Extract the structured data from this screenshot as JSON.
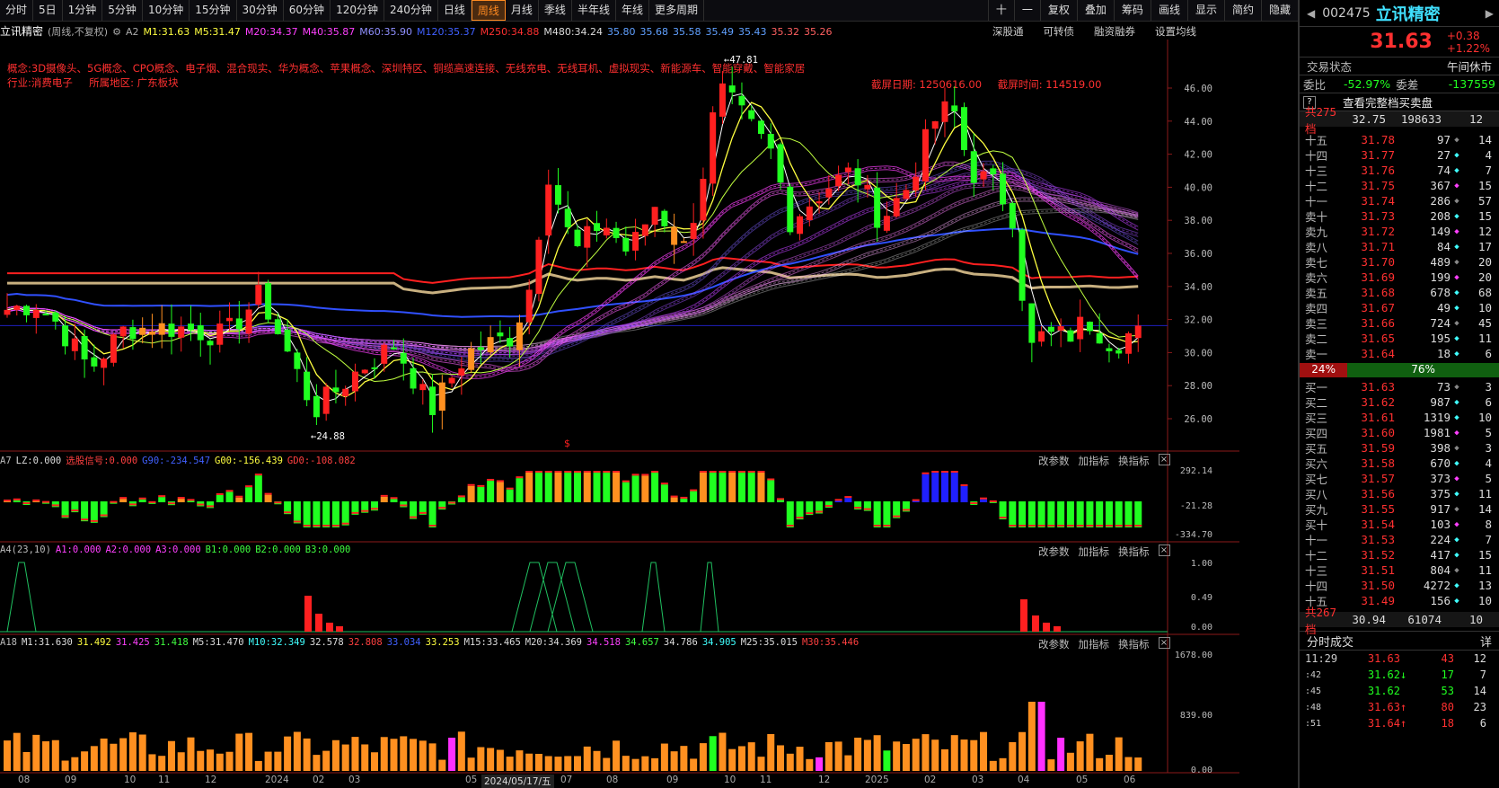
{
  "period_bar": {
    "items": [
      "分时",
      "5日",
      "1分钟",
      "5分钟",
      "10分钟",
      "15分钟",
      "30分钟",
      "60分钟",
      "120分钟",
      "240分钟",
      "日线",
      "周线",
      "月线",
      "季线",
      "半年线",
      "年线",
      "更多周期"
    ],
    "active": "周线",
    "right": [
      "十",
      "一",
      "复权",
      "叠加",
      "筹码",
      "画线",
      "显示",
      "简约",
      "隐藏"
    ]
  },
  "main_info": {
    "name": "立讯精密",
    "mode": "(周线,不复权)",
    "formula": "A2",
    "items": [
      {
        "t": "M1:31.63",
        "c": "#ffff40"
      },
      {
        "t": "M5:31.47",
        "c": "#ffff40"
      },
      {
        "t": "M20:34.37",
        "c": "#ff40ff"
      },
      {
        "t": "M40:35.87",
        "c": "#ff40ff"
      },
      {
        "t": "M60:35.90",
        "c": "#9090ff"
      },
      {
        "t": "M120:35.37",
        "c": "#4060ff"
      },
      {
        "t": "M250:34.88",
        "c": "#ff3030"
      },
      {
        "t": "M480:34.24",
        "c": "#ddd"
      },
      {
        "t": "35.80",
        "c": "#60a0ff"
      },
      {
        "t": "35.68",
        "c": "#60a0ff"
      },
      {
        "t": "35.58",
        "c": "#60a0ff"
      },
      {
        "t": "35.49",
        "c": "#60a0ff"
      },
      {
        "t": "35.43",
        "c": "#60a0ff"
      },
      {
        "t": "35.32",
        "c": "#ff6060"
      },
      {
        "t": "35.26",
        "c": "#ff6060"
      }
    ]
  },
  "links": [
    "深股通",
    "可转债",
    "融资融券",
    "设置均线"
  ],
  "concepts": "概念:3D摄像头、5G概念、CPO概念、电子烟、混合现实、华为概念、苹果概念、深圳特区、铜缆高速连接、无线充电、无线耳机、虚拟现实、新能源车、智能穿戴、智能家居",
  "industry": "行业:消费电子",
  "region": "所属地区: 广东板块",
  "snapshot": {
    "date": "截屏日期: 1250616.00",
    "time": "截屏时间: 114519.00"
  },
  "price_axis": [
    "46.00",
    "44.00",
    "42.00",
    "40.00",
    "38.00",
    "36.00",
    "34.00",
    "32.00",
    "30.00",
    "28.00",
    "26.00"
  ],
  "hi_label": "47.81",
  "lo_label": "24.88",
  "sub1": {
    "title": "A7",
    "items": [
      {
        "t": "LZ:0.000",
        "c": "#ddd"
      },
      {
        "t": "选股信号:0.000",
        "c": "#ff4040"
      },
      {
        "t": "G90:-234.547",
        "c": "#4060ff"
      },
      {
        "t": "G00:-156.439",
        "c": "#ffff40"
      },
      {
        "t": "GD0:-108.082",
        "c": "#ff4040"
      }
    ],
    "axis": [
      "292.14",
      "-21.28",
      "-334.70"
    ]
  },
  "sub2": {
    "title": "A4(23,10)",
    "items": [
      {
        "t": "A1:0.000",
        "c": "#ff40ff"
      },
      {
        "t": "A2:0.000",
        "c": "#ff40ff"
      },
      {
        "t": "A3:0.000",
        "c": "#ff40ff"
      },
      {
        "t": "B1:0.000",
        "c": "#40ff40"
      },
      {
        "t": "B2:0.000",
        "c": "#40ff40"
      },
      {
        "t": "B3:0.000",
        "c": "#40ff40"
      }
    ],
    "axis": [
      "1.00",
      "0.49",
      "0.00"
    ]
  },
  "sub3": {
    "title": "A18",
    "items": [
      {
        "t": "M1:31.630",
        "c": "#ddd"
      },
      {
        "t": "31.492",
        "c": "#ffff40"
      },
      {
        "t": "31.425",
        "c": "#ff40ff"
      },
      {
        "t": "31.418",
        "c": "#40ff40"
      },
      {
        "t": "M5:31.470",
        "c": "#ddd"
      },
      {
        "t": "M10:32.349",
        "c": "#40ffff"
      },
      {
        "t": "32.578",
        "c": "#ddd"
      },
      {
        "t": "32.808",
        "c": "#ff4040"
      },
      {
        "t": "33.034",
        "c": "#4060ff"
      },
      {
        "t": "33.253",
        "c": "#ffff40"
      },
      {
        "t": "M15:33.465",
        "c": "#ddd"
      },
      {
        "t": "M20:34.369",
        "c": "#ddd"
      },
      {
        "t": "34.518",
        "c": "#ff40ff"
      },
      {
        "t": "34.657",
        "c": "#40ff40"
      },
      {
        "t": "34.786",
        "c": "#ddd"
      },
      {
        "t": "34.905",
        "c": "#40ffff"
      },
      {
        "t": "M25:35.015",
        "c": "#ddd"
      },
      {
        "t": "M30:35.446",
        "c": "#ff4040"
      }
    ],
    "axis": [
      "1678.00",
      "839.00",
      "0.00"
    ]
  },
  "sub_btns": [
    "改参数",
    "加指标",
    "换指标"
  ],
  "xaxis": [
    "08",
    "09",
    "10",
    "11",
    "12",
    "2024",
    "02",
    "03",
    "05",
    "2024/05/17/五",
    "07",
    "08",
    "09",
    "10",
    "11",
    "12",
    "2025",
    "02",
    "03",
    "04",
    "05",
    "06"
  ],
  "quote": {
    "code": "002475",
    "name": "立讯精密",
    "price": "31.63",
    "change": "+0.38",
    "pct": "+1.22%",
    "status_label": "交易状态",
    "status": "午间休市",
    "wb_label": "委比",
    "wb": "-52.97%",
    "wc_label": "委差",
    "wc": "-137559",
    "full_btn": "查看完整档买卖盘",
    "sell_total": {
      "lbl": "共275档",
      "price": "32.75",
      "vol": "198633",
      "cnt": "12"
    },
    "sells": [
      [
        "十五",
        "31.78",
        "97",
        "14"
      ],
      [
        "十四",
        "31.77",
        "27",
        "4"
      ],
      [
        "十三",
        "31.76",
        "74",
        "7"
      ],
      [
        "十二",
        "31.75",
        "367",
        "15"
      ],
      [
        "十一",
        "31.74",
        "286",
        "57"
      ],
      [
        "卖十",
        "31.73",
        "208",
        "15"
      ],
      [
        "卖九",
        "31.72",
        "149",
        "12"
      ],
      [
        "卖八",
        "31.71",
        "84",
        "17"
      ],
      [
        "卖七",
        "31.70",
        "489",
        "20"
      ],
      [
        "卖六",
        "31.69",
        "199",
        "20"
      ],
      [
        "卖五",
        "31.68",
        "678",
        "68"
      ],
      [
        "卖四",
        "31.67",
        "49",
        "10"
      ],
      [
        "卖三",
        "31.66",
        "724",
        "45"
      ],
      [
        "卖二",
        "31.65",
        "195",
        "11"
      ],
      [
        "卖一",
        "31.64",
        "18",
        "6"
      ]
    ],
    "ratio_left": "24%",
    "ratio_right": "76%",
    "buys": [
      [
        "买一",
        "31.63",
        "73",
        "3"
      ],
      [
        "买二",
        "31.62",
        "987",
        "6"
      ],
      [
        "买三",
        "31.61",
        "1319",
        "10"
      ],
      [
        "买四",
        "31.60",
        "1981",
        "5"
      ],
      [
        "买五",
        "31.59",
        "398",
        "3"
      ],
      [
        "买六",
        "31.58",
        "670",
        "4"
      ],
      [
        "买七",
        "31.57",
        "373",
        "5"
      ],
      [
        "买八",
        "31.56",
        "375",
        "11"
      ],
      [
        "买九",
        "31.55",
        "917",
        "14"
      ],
      [
        "买十",
        "31.54",
        "103",
        "8"
      ],
      [
        "十一",
        "31.53",
        "224",
        "7"
      ],
      [
        "十二",
        "31.52",
        "417",
        "15"
      ],
      [
        "十三",
        "31.51",
        "804",
        "11"
      ],
      [
        "十四",
        "31.50",
        "4272",
        "13"
      ],
      [
        "十五",
        "31.49",
        "156",
        "10"
      ]
    ],
    "buy_total": {
      "lbl": "共267档",
      "price": "30.94",
      "vol": "61074",
      "cnt": "10"
    },
    "ticks_title": "分时成交",
    "ticks_btn": "详",
    "ticks": [
      [
        "11:29",
        "31.63",
        "43",
        "12"
      ],
      [
        ":42",
        "31.62",
        "17",
        "7"
      ],
      [
        ":45",
        "31.62",
        "53",
        "14"
      ],
      [
        ":48",
        "31.63",
        "80",
        "23"
      ],
      [
        ":51",
        "31.64",
        "18",
        "6"
      ]
    ]
  },
  "colors": {
    "up": "#ff2020",
    "down": "#20ff20",
    "accent": "#ff8a20"
  }
}
